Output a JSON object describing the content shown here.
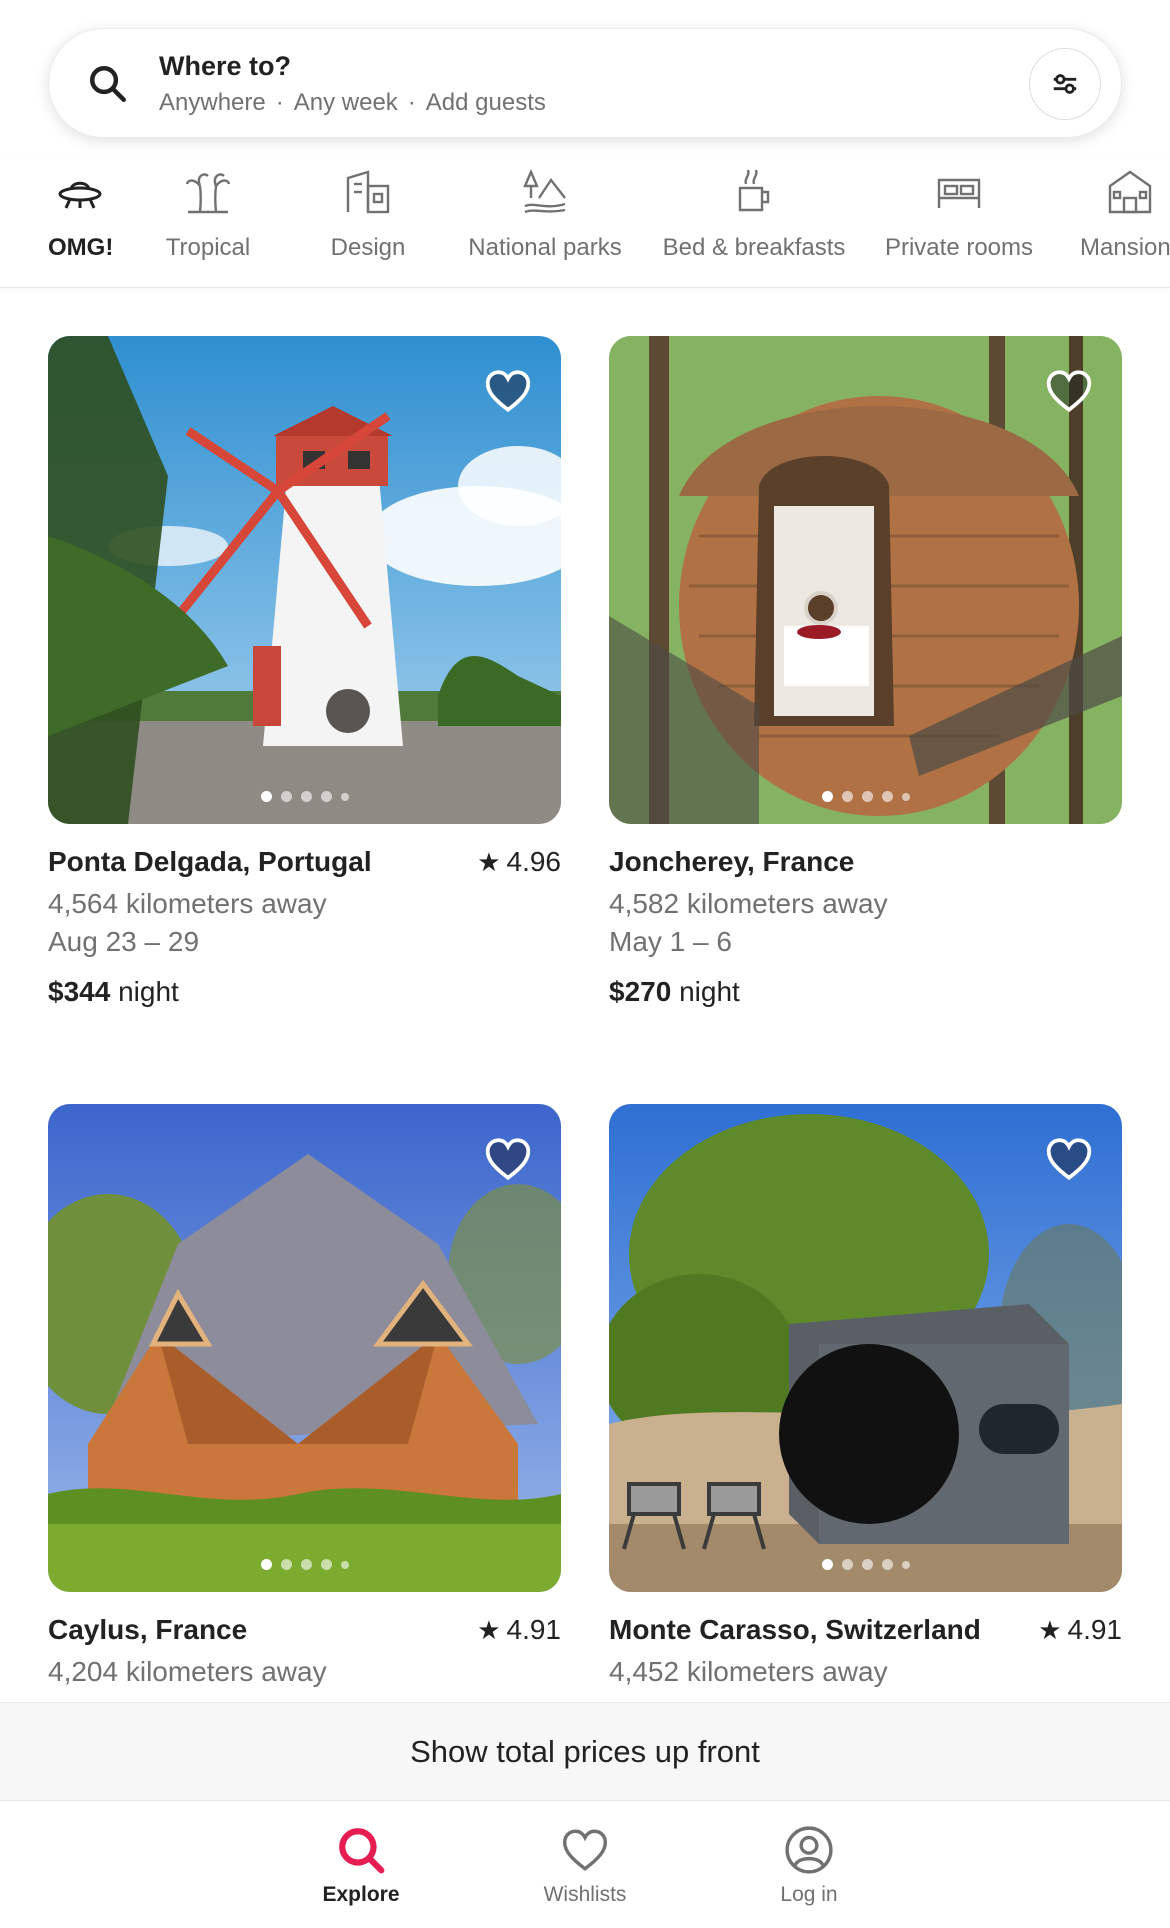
{
  "search": {
    "title": "Where to?",
    "where": "Anywhere",
    "when": "Any week",
    "guests": "Add guests",
    "separator": "·"
  },
  "categories": [
    {
      "label": "OMG!",
      "icon": "ufo-icon",
      "active": true
    },
    {
      "label": "Tropical",
      "icon": "palm-tree-icon"
    },
    {
      "label": "Design",
      "icon": "building-icon"
    },
    {
      "label": "National parks",
      "icon": "park-icon"
    },
    {
      "label": "Bed & breakfasts",
      "icon": "coffee-cup-icon"
    },
    {
      "label": "Private rooms",
      "icon": "bed-icon"
    },
    {
      "label": "Mansion",
      "icon": "mansion-icon"
    }
  ],
  "listings": [
    {
      "location": "Ponta Delgada, Portugal",
      "rating": "4.96",
      "distance": "4,564 kilometers away",
      "dates": "Aug 23 – 29",
      "price": "$344",
      "price_unit": "night",
      "photo": "windmill"
    },
    {
      "location": "Joncherey, France",
      "rating": "",
      "distance": "4,582 kilometers away",
      "dates": "May 1 – 6",
      "price": "$270",
      "price_unit": "night",
      "photo": "treehouse pod"
    },
    {
      "location": "Caylus, France",
      "rating": "4.91",
      "distance": "4,204 kilometers away",
      "photo": "geodesic wooden dome"
    },
    {
      "location": "Monte Carasso, Switzerland",
      "rating": "4.91",
      "distance": "4,452 kilometers away",
      "photo": "dark cube cabin"
    }
  ],
  "banner": {
    "text": "Show total prices up front"
  },
  "nav": {
    "explore": "Explore",
    "wishlists": "Wishlists",
    "login": "Log in"
  },
  "colors": {
    "accent": "#E51D53",
    "text": "#222222",
    "muted": "#717171"
  }
}
